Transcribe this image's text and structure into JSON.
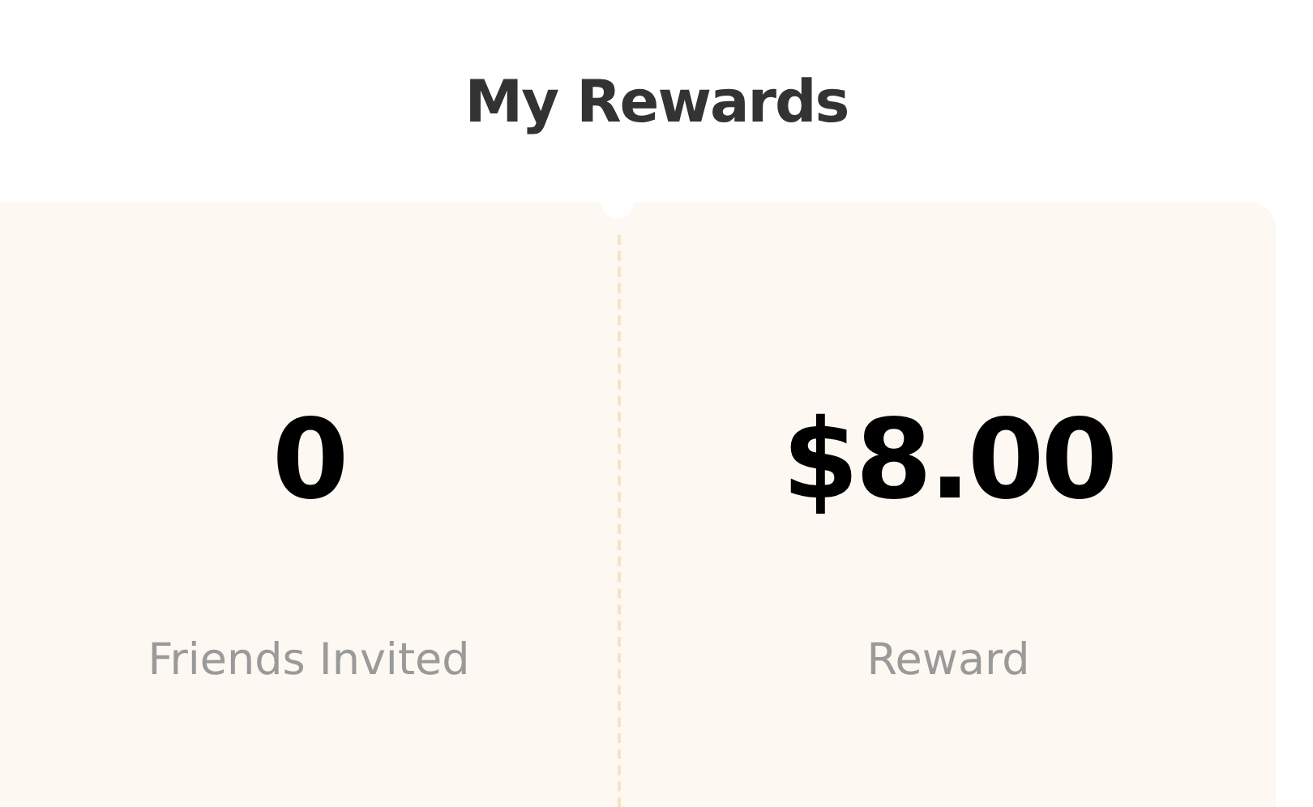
{
  "title": "My Rewards",
  "stats": [
    {
      "value": "0",
      "label": "Friends Invited"
    },
    {
      "value": "$8.00",
      "label": "Reward"
    }
  ]
}
